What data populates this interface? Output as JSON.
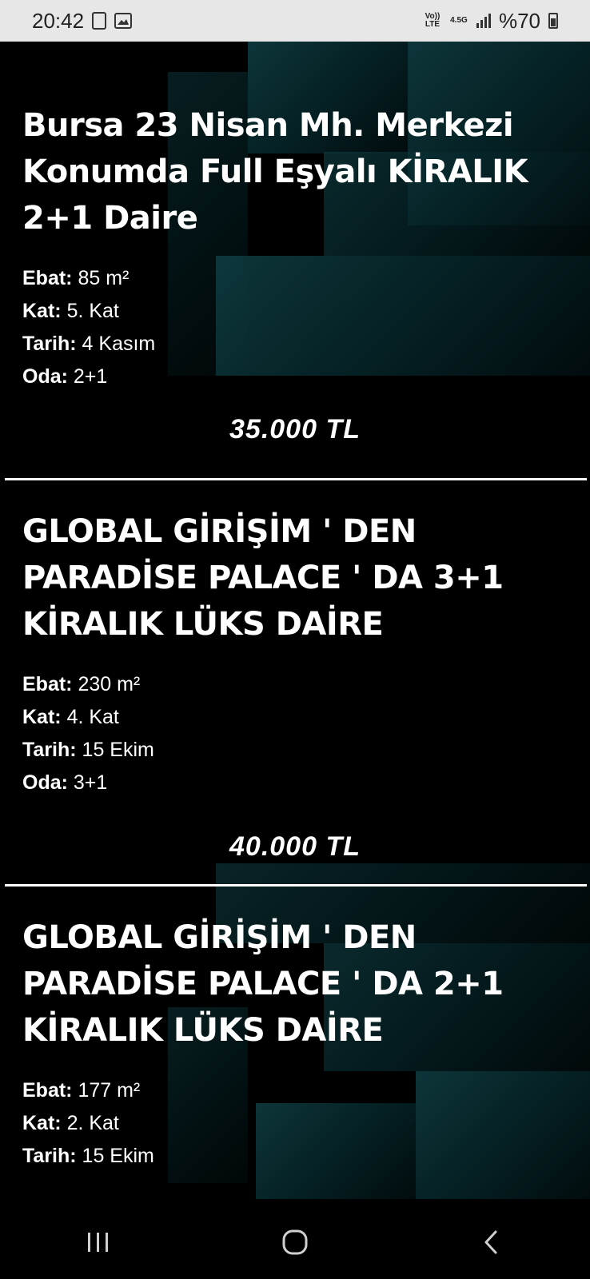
{
  "status_bar": {
    "time": "20:42",
    "network_label": "4.5G",
    "volte_label": "Vo)) LTE",
    "battery_text": "%70",
    "icons": [
      "sim-icon",
      "gallery-icon",
      "volte-icon",
      "network-icon",
      "signal-icon",
      "battery-icon"
    ]
  },
  "listings": [
    {
      "title": "Bursa 23 Nisan Mh. Merkezi Konumda Full Eşyalı KİRALIK 2+1 Daire",
      "details": [
        {
          "key": "Ebat:",
          "value": "85 m²"
        },
        {
          "key": "Kat:",
          "value": "5. Kat"
        },
        {
          "key": "Tarih:",
          "value": "4 Kasım"
        },
        {
          "key": "Oda:",
          "value": "2+1"
        }
      ],
      "price": "35.000 TL"
    },
    {
      "title": "GLOBAL GİRİŞİM ' DEN PARADİSE PALACE ' DA 3+1 KİRALIK LÜKS DAİRE",
      "details": [
        {
          "key": "Ebat:",
          "value": "230 m²"
        },
        {
          "key": "Kat:",
          "value": "4. Kat"
        },
        {
          "key": "Tarih:",
          "value": "15 Ekim"
        },
        {
          "key": "Oda:",
          "value": "3+1"
        }
      ],
      "price": "40.000 TL"
    },
    {
      "title": "GLOBAL GİRİŞİM ' DEN PARADİSE PALACE ' DA 2+1 KİRALIK LÜKS DAİRE",
      "details": [
        {
          "key": "Ebat:",
          "value": "177 m²"
        },
        {
          "key": "Kat:",
          "value": "2. Kat"
        },
        {
          "key": "Tarih:",
          "value": "15 Ekim"
        }
      ]
    }
  ],
  "nav_bar": {
    "icons": [
      "recent-apps-icon",
      "home-icon",
      "back-icon"
    ]
  },
  "colors": {
    "background": "#000000",
    "accent_teal": "#0f3b40",
    "status_bar": "#e7e7e7"
  }
}
